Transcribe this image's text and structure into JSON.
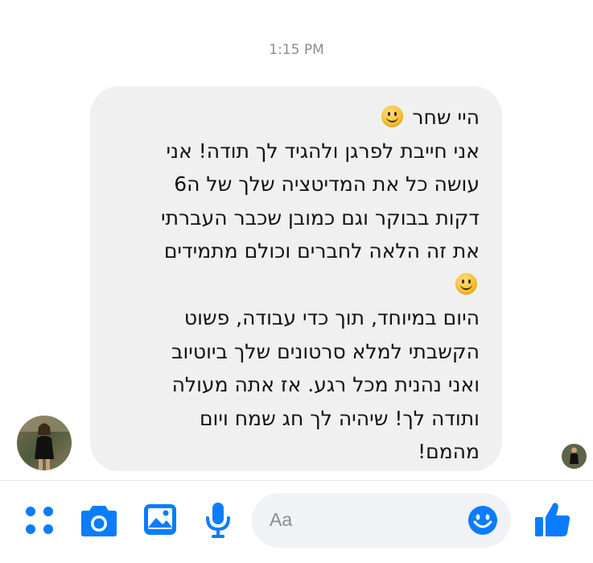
{
  "timestamp": "1:15 PM",
  "message": {
    "lines": [
      "היי שחר",
      "אני חייבת לפרגן ולהגיד לך תודה! אני",
      "עושה כל את המדיטציה שלך של ה6",
      "דקות בבוקר וגם כמובן שכבר העברתי",
      "את זה הלאה לחברים וכולם מתמידים",
      "",
      "היום במיוחד, תוך כדי עבודה, פשוט",
      "הקשבתי למלא סרטונים שלך ביוטיוב",
      "ואני נהנית מכל רגע. אז אתה מעולה",
      "ותודה לך! שיהיה לך חג שמח ויום",
      "מהמם!"
    ],
    "emojis": [
      "slightly-smiling-face",
      "slightly-smiling-face"
    ]
  },
  "composer": {
    "placeholder": "Aa"
  },
  "toolbar": {
    "icons": [
      "menu-dots-icon",
      "camera-icon",
      "gallery-icon",
      "microphone-icon",
      "emoji-icon",
      "thumbs-up-icon"
    ]
  },
  "colors": {
    "accent": "#0a7cff",
    "bubble_background": "#f0f0f0",
    "timestamp_text": "#8a8d91"
  }
}
